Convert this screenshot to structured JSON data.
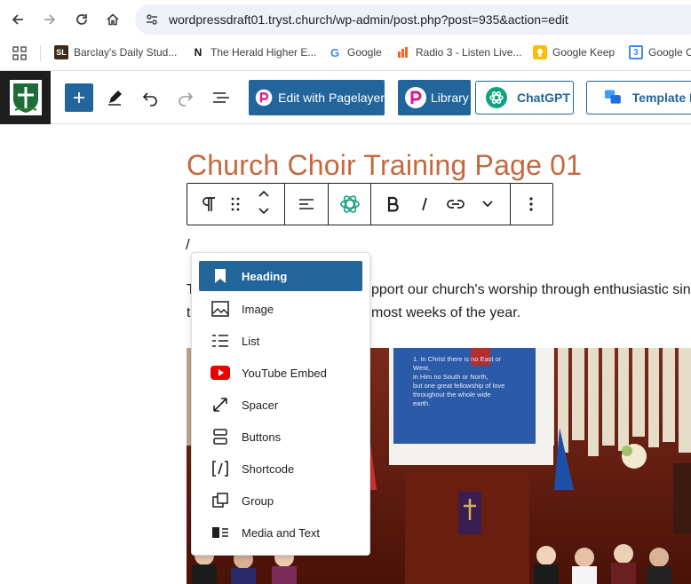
{
  "browser": {
    "url": "wordpressdraft01.tryst.church/wp-admin/post.php?post=935&action=edit",
    "bookmarks": [
      {
        "label": "Barclay's Daily Stud...",
        "icon": "sl-favicon",
        "icon_text": "SL"
      },
      {
        "label": "The Herald Higher E...",
        "icon": "herald-favicon",
        "icon_text": "N"
      },
      {
        "label": "Google",
        "icon": "google-favicon",
        "icon_text": "G"
      },
      {
        "label": "Radio 3 - Listen Live...",
        "icon": "radio3-favicon",
        "icon_text": ""
      },
      {
        "label": "Google Keep",
        "icon": "keep-favicon",
        "icon_text": ""
      },
      {
        "label": "Google C",
        "icon": "calendar-favicon",
        "icon_text": "3"
      }
    ]
  },
  "wp_toolbar": {
    "edit_pagelayer": "Edit with Pagelayer",
    "library": "Library",
    "chatgpt": "ChatGPT",
    "template_kit": "Template Ki"
  },
  "editor": {
    "title": "Church Choir Training Page 01",
    "slash_text": "/",
    "para_line1_start": "T",
    "para_line1_rest": "pport our church's worship through enthusiastic sin",
    "para_line2_start": "t",
    "para_line2_rest": "most weeks of the year."
  },
  "slide": {
    "lines": [
      "1. In Christ there is no East or",
      "West,",
      "in Him no South or North,",
      "but one great fellowship of love",
      "throughout the whole wide",
      "earth."
    ]
  },
  "inserter": {
    "items": [
      {
        "label": "Heading",
        "icon": "heading-icon",
        "active": true
      },
      {
        "label": "Image",
        "icon": "image-icon",
        "active": false
      },
      {
        "label": "List",
        "icon": "list-icon",
        "active": false
      },
      {
        "label": "YouTube Embed",
        "icon": "youtube-icon",
        "active": false
      },
      {
        "label": "Spacer",
        "icon": "spacer-icon",
        "active": false
      },
      {
        "label": "Buttons",
        "icon": "buttons-icon",
        "active": false
      },
      {
        "label": "Shortcode",
        "icon": "shortcode-icon",
        "active": false
      },
      {
        "label": "Group",
        "icon": "group-icon",
        "active": false
      },
      {
        "label": "Media and Text",
        "icon": "media-text-icon",
        "active": false
      }
    ]
  },
  "colors": {
    "wp_blue": "#21659b",
    "title": "#c3683f",
    "active_item": "#21659b"
  }
}
